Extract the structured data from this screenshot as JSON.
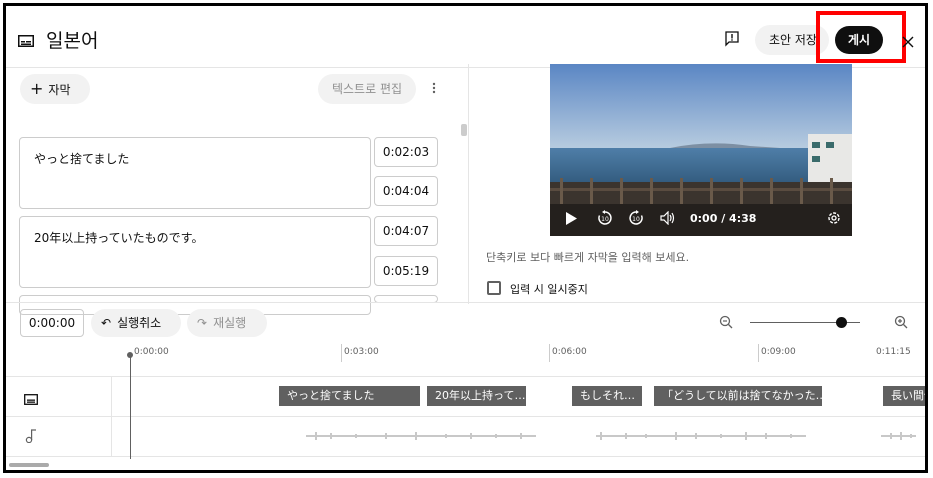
{
  "header": {
    "title": "일본어",
    "draft_label": "초안 저장",
    "publish_label": "게시"
  },
  "editor": {
    "add_subtitle_label": "자막",
    "edit_as_text_label": "텍스트로 편집",
    "captions": [
      {
        "text": "やっと捨てました",
        "start": "0:02:03",
        "end": "0:04:04"
      },
      {
        "text": "20年以上持っていたものです。",
        "start": "0:04:07",
        "end": "0:05:19"
      }
    ]
  },
  "video": {
    "time_display": "0:00 / 4:38"
  },
  "options": {
    "shortcut_hint": "단축키로 보다 빠르게 자막을 입력해 보세요.",
    "pause_while_typing_label": "입력 시 일시중지"
  },
  "timeline": {
    "timecode": "0:00:00",
    "undo_label": "실행취소",
    "redo_label": "재실행",
    "ruler": [
      "0:00:00",
      "0:03:00",
      "0:06:00",
      "0:09:00",
      "0:11:15"
    ],
    "segments": [
      "やっと捨てました",
      "20年以上持って…",
      "もしそれ…",
      "「どうして以前は捨てなかった…",
      "長い間使"
    ]
  },
  "colors": {
    "accent_highlight": "#ff0000",
    "publish_bg": "#0f0f0f",
    "segment_bg": "#606060"
  },
  "icons": [
    "subtitles-icon",
    "feedback-icon",
    "close-icon",
    "plus-icon",
    "more-vert-icon",
    "play-icon",
    "rewind-10-icon",
    "forward-10-icon",
    "volume-icon",
    "settings-icon",
    "undo-icon",
    "redo-icon",
    "zoom-out-icon",
    "zoom-in-icon",
    "music-note-icon"
  ]
}
